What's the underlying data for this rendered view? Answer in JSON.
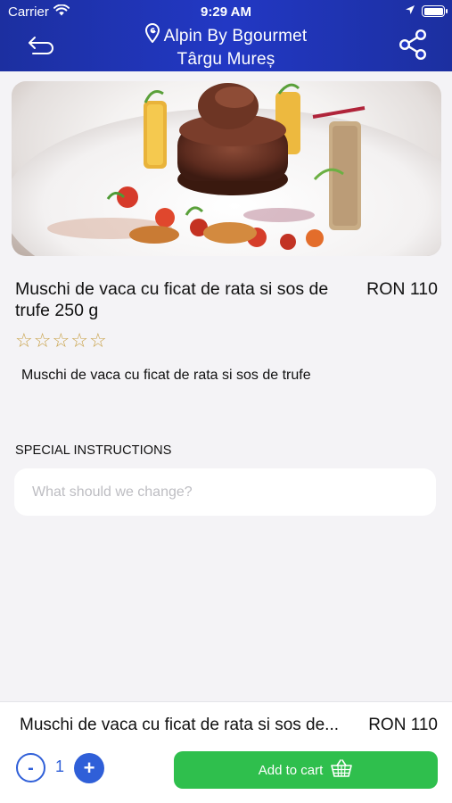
{
  "status_bar": {
    "carrier": "Carrier",
    "time": "9:29 AM"
  },
  "nav": {
    "restaurant_name": "Alpin By Bgourmet",
    "city": "Târgu Mureș",
    "back_icon": "back-arrow-icon",
    "share_icon": "share-icon",
    "location_icon": "location-pin-icon"
  },
  "product": {
    "name": "Muschi de vaca  cu ficat de rata si sos de  trufe 250 g",
    "price": "RON 110",
    "rating": 0,
    "rating_max": 5,
    "stars": [
      "☆",
      "☆",
      "☆",
      "☆",
      "☆"
    ],
    "description": "Muschi de vaca  cu ficat de rata si sos de  trufe"
  },
  "special_instructions": {
    "label": "SPECIAL INSTRUCTIONS",
    "placeholder": "What should we change?",
    "value": ""
  },
  "footer": {
    "name": "Muschi de vaca  cu ficat de rata si sos de...",
    "price": "RON 110",
    "minus_label": "-",
    "quantity": "1",
    "plus_label": "+",
    "add_to_cart_label": "Add to cart",
    "cart_icon": "basket-icon"
  },
  "colors": {
    "header": "#2238c4",
    "accent_blue": "#2f5fd8",
    "cart_green": "#2fbf4d",
    "star": "#c9a24a",
    "background": "#f4f3f6"
  }
}
